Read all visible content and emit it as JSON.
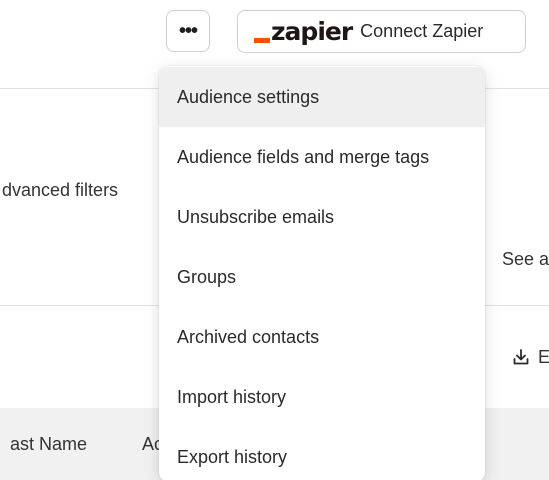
{
  "toolbar": {
    "more_label": "•••",
    "zapier_logo_text": "zapier",
    "zapier_label": "Connect Zapier"
  },
  "background": {
    "filters_label": "dvanced filters",
    "see_all_label": "See a",
    "export_label": "E",
    "table_headers": [
      "ast Name",
      "Ac"
    ]
  },
  "menu": {
    "items": [
      {
        "label": "Audience settings",
        "active": true
      },
      {
        "label": "Audience fields and merge tags",
        "active": false
      },
      {
        "label": "Unsubscribe emails",
        "active": false
      },
      {
        "label": "Groups",
        "active": false
      },
      {
        "label": "Archived contacts",
        "active": false
      },
      {
        "label": "Import history",
        "active": false
      },
      {
        "label": "Export history",
        "active": false
      }
    ]
  },
  "colors": {
    "zapier_orange": "#ff4f00",
    "hover_background": "#efefef",
    "table_header_background": "#f1f1f1"
  },
  "icons": {
    "more": "more-horizontal-icon",
    "export": "download-icon"
  }
}
